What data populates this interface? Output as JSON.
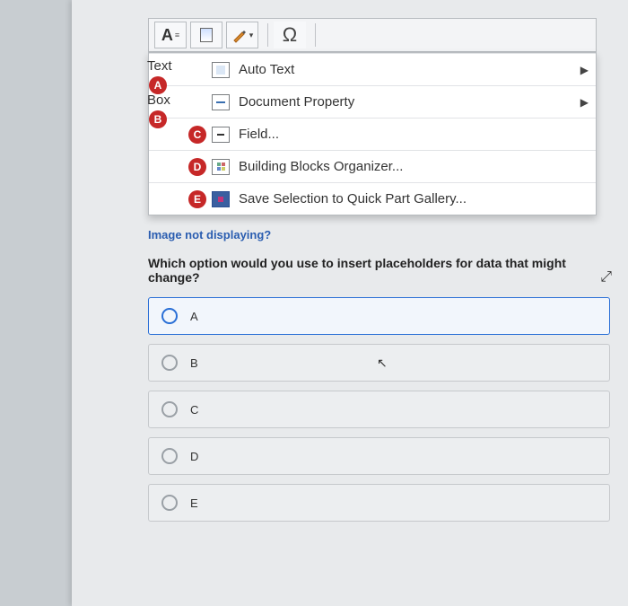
{
  "ribbon": {
    "btn_text_a": "A",
    "btn_omega": "Ω"
  },
  "textbox_label_line1": "Text",
  "textbox_label_line2": "Box",
  "menu": {
    "badges": {
      "a": "A",
      "b": "B",
      "c": "C",
      "d": "D",
      "e": "E"
    },
    "items": {
      "auto_text": "Auto Text",
      "doc_property": "Document Property",
      "field": "Field...",
      "building_blocks": "Building Blocks Organizer...",
      "save_selection": "Save Selection to Quick Part Gallery..."
    }
  },
  "image_link": "Image not displaying?",
  "question": "Which option would you use to insert placeholders for data that might change?",
  "answers": {
    "a": "A",
    "b": "B",
    "c": "C",
    "d": "D",
    "e": "E"
  },
  "selected_answer": "a"
}
